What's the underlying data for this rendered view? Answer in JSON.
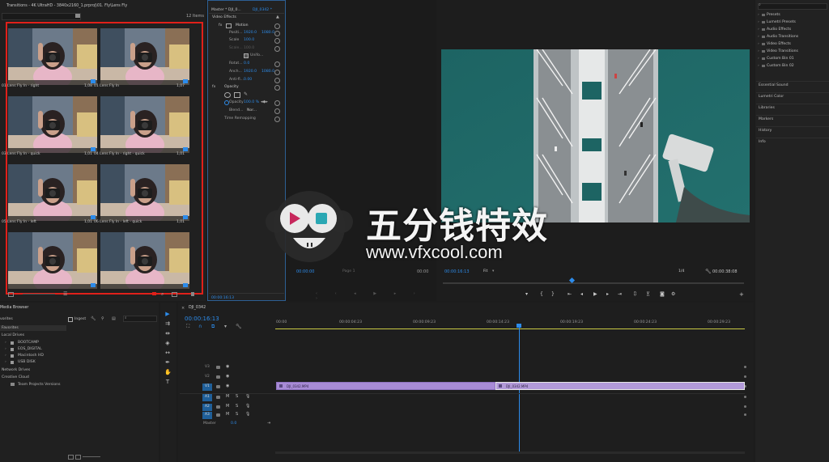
{
  "project_panel": {
    "path": "Transitions - 4K UltraHD - 3840x2160_1.prproj\\01. Fly\\Lens Fly",
    "item_count": "12 Items",
    "items": [
      {
        "name": "01 Lens Fly In - right",
        "duration": "1,08"
      },
      {
        "name": "01 Lens Fly In",
        "duration": "1,07"
      },
      {
        "name": "03 Lens Fly In - quick",
        "duration": "1,01"
      },
      {
        "name": "04 Lens Fly In - right - quick",
        "duration": "1,01"
      },
      {
        "name": "05 Lens Fly In - left",
        "duration": "1,01"
      },
      {
        "name": "06 Lens Fly In - left - quick",
        "duration": "1,01"
      },
      {
        "name": "",
        "duration": ""
      },
      {
        "name": "",
        "duration": ""
      }
    ]
  },
  "effect_controls": {
    "tab_master": "Master * DJI_0...",
    "tab_clip": "DJI_0342 *",
    "section_video": "Video Effects",
    "motion": "Motion",
    "position_label": "Positi...",
    "position_x": "1920.0",
    "position_y": "1080.0",
    "scale_label": "Scale",
    "scale_val": "100.0",
    "scale_w_label": "Scale...",
    "scale_w_val": "100.0",
    "uniform": "Unifo...",
    "rotation_label": "Rotat...",
    "rotation_val": "0.0",
    "anchor_label": "Anch...",
    "anchor_x": "1920.0",
    "anchor_y": "1080.0",
    "antiflicker_label": "Anti-fl...",
    "antiflicker_val": "0.00",
    "opacity": "Opacity",
    "opacity_label": "Opacity",
    "opacity_val": "100.0 %",
    "blend_label": "Blend...",
    "blend_val": "Nor...",
    "time_remap": "Time Remapping",
    "timecode": "00:00:16:13"
  },
  "source_monitor": {
    "timecode_left": "00:00:00",
    "page": "Page 1",
    "timecode_right": "00:00"
  },
  "program_monitor": {
    "timecode": "00:00:16:13",
    "fit": "Fit",
    "ratio": "1/4",
    "duration": "00:00:38:08"
  },
  "effects_panel": {
    "search_placeholder": "",
    "items": [
      "Presets",
      "Lumetri Presets",
      "Audio Effects",
      "Audio Transitions",
      "Video Effects",
      "Video Transitions",
      "Custom Bin 01",
      "Custom Bin 02"
    ],
    "panels": [
      "Essential Sound",
      "Lumetri Color",
      "Libraries",
      "Markers",
      "History",
      "Info"
    ]
  },
  "media_browser": {
    "tab": "Media Browser",
    "favorites_tab": "vorites",
    "ingest": "Ingest",
    "sections": {
      "favorites": "Favorites",
      "local": "Local Drives",
      "network": "Network Drives",
      "creative": "Creative Cloud"
    },
    "drives": [
      "BOOTCAMP",
      "EOS_DIGITAL",
      "Macintosh HD",
      "USB DISK"
    ],
    "team": "Team Projects Versions"
  },
  "timeline": {
    "sequence": "DJI_0342",
    "timecode": "00:00:16:13",
    "ruler": [
      "00:00",
      "00:00:04:23",
      "00:00:09:23",
      "00:00:14:23",
      "00:00:19:23",
      "00:00:24:23",
      "00:00:29:23"
    ],
    "tracks": [
      "V3",
      "V2",
      "V1",
      "A1",
      "A2",
      "A3"
    ],
    "master_label": "Master",
    "master_val": "0.0",
    "clip_a": "DJI_0342.MP4",
    "clip_b": "DJI_0342.MP4"
  },
  "watermark": {
    "cn": "五分钱特效",
    "url": "www.vfxcool.com"
  },
  "colors": {
    "accent_blue": "#2d8ceb",
    "clip_purple": "#a88bd6",
    "highlight_red": "#e0201a"
  }
}
